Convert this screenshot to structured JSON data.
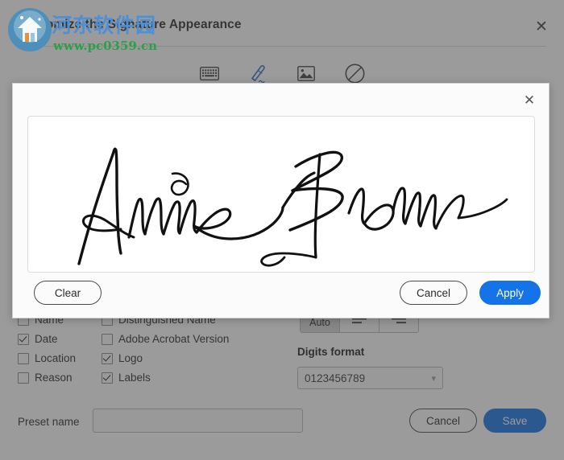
{
  "base_window": {
    "title": "Customize the Signature Appearance",
    "close_icon": "close-icon"
  },
  "mode_toolbar": {
    "items": [
      {
        "id": "type",
        "icon": "keyboard-icon",
        "label": "Type",
        "selected": false
      },
      {
        "id": "draw",
        "icon": "pen-draw-icon",
        "label": "Draw",
        "selected": true
      },
      {
        "id": "image",
        "icon": "image-icon",
        "label": "Image",
        "selected": false
      },
      {
        "id": "none",
        "icon": "no-symbol-icon",
        "label": "None",
        "selected": false
      }
    ]
  },
  "options": {
    "checkboxes": [
      {
        "label": "Name",
        "checked": false
      },
      {
        "label": "Distinguished Name",
        "checked": false
      },
      {
        "label": "Date",
        "checked": true
      },
      {
        "label": "Adobe Acrobat Version",
        "checked": false
      },
      {
        "label": "Location",
        "checked": false
      },
      {
        "label": "Logo",
        "checked": true
      },
      {
        "label": "Reason",
        "checked": false
      },
      {
        "label": "Labels",
        "checked": true
      }
    ],
    "align_group": [
      {
        "id": "auto",
        "label": "Auto",
        "icon": "",
        "selected": true
      },
      {
        "id": "align-left",
        "label": "",
        "icon": "align-left-icon",
        "selected": false
      },
      {
        "id": "align-right",
        "label": "",
        "icon": "align-right-icon",
        "selected": false
      }
    ],
    "digits_format_label": "Digits format",
    "digits_format_value": "0123456789",
    "digits_chevron_icon": "chevron-down-icon"
  },
  "footer": {
    "preset_name_label": "Preset name",
    "preset_name_value": "",
    "preset_name_placeholder": "",
    "cancel_label": "Cancel",
    "save_label": "Save"
  },
  "signature_modal": {
    "close_icon": "close-icon",
    "signature_text": "Annie Brown",
    "clear_label": "Clear",
    "cancel_label": "Cancel",
    "apply_label": "Apply"
  },
  "watermark": {
    "site_name_cn": "河东软件园",
    "site_url": "www.pc0359.cn",
    "logo_icon": "site-logo-icon"
  },
  "colors": {
    "accent_blue": "#1473e6",
    "draw_icon_blue": "#2a6ebb",
    "watermark_blue": "#4a90d9",
    "watermark_green": "#2e9e4a",
    "overlay": "rgba(64,64,64,0.52)"
  }
}
